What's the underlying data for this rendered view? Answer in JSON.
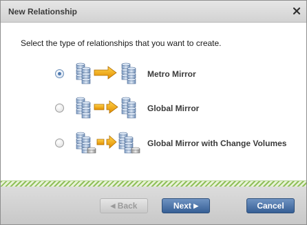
{
  "dialog": {
    "title": "New Relationship",
    "close_icon": "close-icon"
  },
  "instruction": "Select the type of relationships that you want to create.",
  "options": [
    {
      "label": "Metro Mirror",
      "selected": true,
      "icon": "metro-mirror-icon"
    },
    {
      "label": "Global Mirror",
      "selected": false,
      "icon": "global-mirror-icon"
    },
    {
      "label": "Global Mirror with Change Volumes",
      "selected": false,
      "icon": "global-mirror-change-volumes-icon"
    }
  ],
  "buttons": {
    "back": "Back",
    "next": "Next",
    "cancel": "Cancel"
  },
  "colors": {
    "primary_button": "#365f95",
    "stripe": "#8fbf5a",
    "arrow": "#f2a612"
  }
}
